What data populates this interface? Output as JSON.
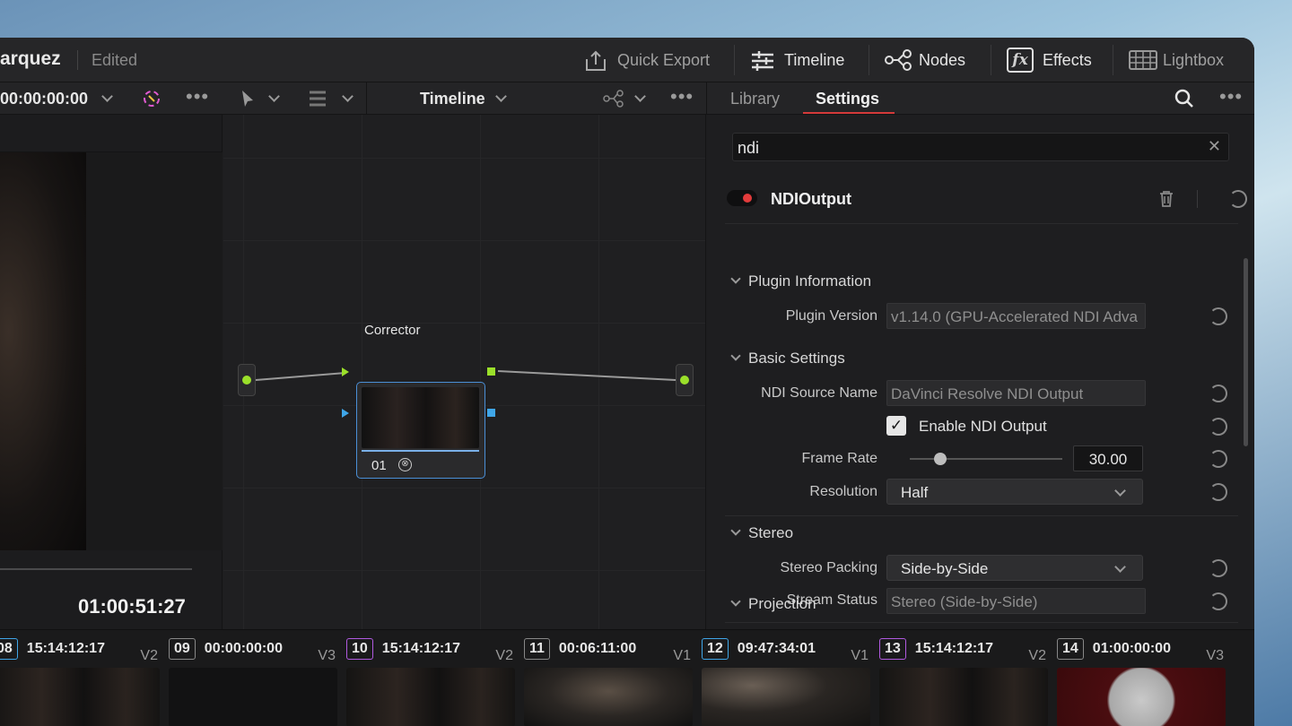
{
  "project": {
    "name": "arquez",
    "status": "Edited"
  },
  "topbar": {
    "quick_export": "Quick Export",
    "timeline": "Timeline",
    "nodes": "Nodes",
    "effects": "Effects",
    "lightbox": "Lightbox"
  },
  "viewer": {
    "timecode_top": "00:00:00:00",
    "timecode_bottom": "01:00:51:27"
  },
  "node_editor": {
    "mode": "Timeline",
    "node_label": "Corrector",
    "node_number": "01"
  },
  "inspector": {
    "tabs": [
      "Library",
      "Settings"
    ],
    "active_tab": "Settings",
    "search_value": "ndi",
    "plugin_name": "NDIOutput",
    "sections": {
      "plugin_information": "Plugin Information",
      "basic_settings": "Basic Settings",
      "stereo": "Stereo",
      "projection": "Projection"
    },
    "fields": {
      "plugin_version_label": "Plugin Version",
      "plugin_version_value": "v1.14.0 (GPU-Accelerated NDI Adva",
      "source_name_label": "NDI Source Name",
      "source_name_value": "DaVinci Resolve NDI Output",
      "enable_label": "Enable NDI Output",
      "frame_rate_label": "Frame Rate",
      "frame_rate_value": "30.00",
      "frame_rate_slider_fraction": 0.2,
      "resolution_label": "Resolution",
      "resolution_value": "Half",
      "stereo_packing_label": "Stereo Packing",
      "stereo_packing_value": "Side-by-Side",
      "stream_status_label": "Stream Status",
      "stream_status_value": "Stereo (Side-by-Side)"
    }
  },
  "clips": [
    {
      "num": "08",
      "tc": "15:14:12:17",
      "track": "V2",
      "color": "#3fa6e8"
    },
    {
      "num": "09",
      "tc": "00:00:00:00",
      "track": "V3",
      "color": "#888888"
    },
    {
      "num": "10",
      "tc": "15:14:12:17",
      "track": "V2",
      "color": "#b05ae0"
    },
    {
      "num": "11",
      "tc": "00:06:11:00",
      "track": "V1",
      "color": "#888888"
    },
    {
      "num": "12",
      "tc": "09:47:34:01",
      "track": "V1",
      "color": "#3fa6e8"
    },
    {
      "num": "13",
      "tc": "15:14:12:17",
      "track": "V2",
      "color": "#b05ae0"
    },
    {
      "num": "14",
      "tc": "01:00:00:00",
      "track": "V3",
      "color": "#888888"
    }
  ]
}
